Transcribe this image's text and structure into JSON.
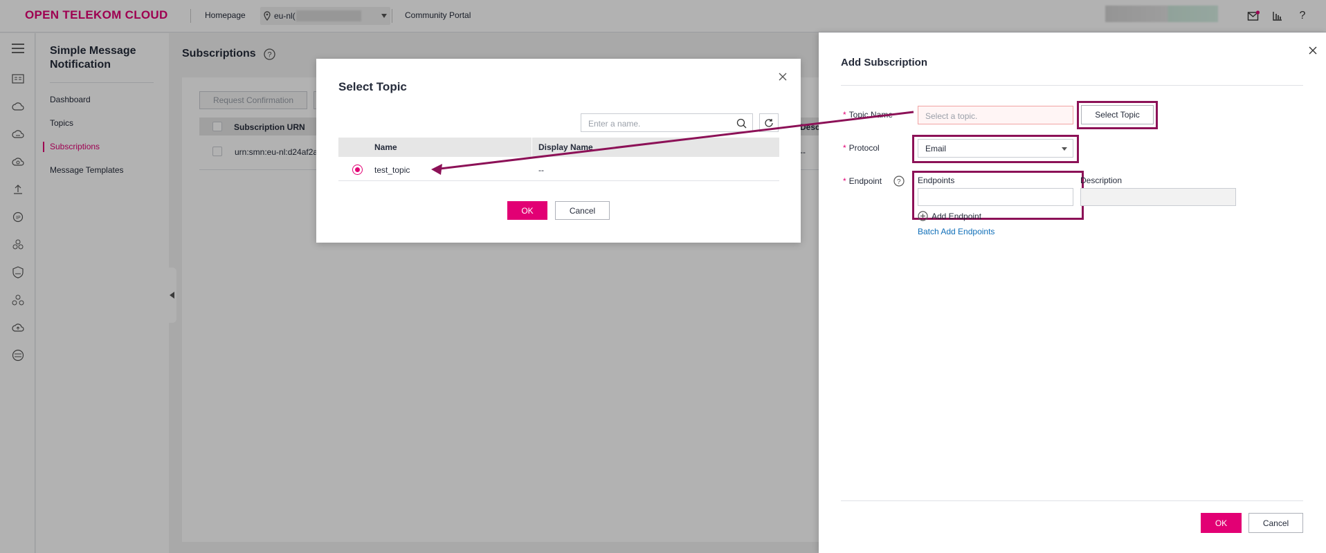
{
  "topbar": {
    "logo": "OPEN TELEKOM CLOUD",
    "homepage": "Homepage",
    "region": "eu-nl(",
    "community": "Community Portal"
  },
  "sidebar": {
    "service_title": "Simple Message Notification",
    "items": [
      {
        "label": "Dashboard"
      },
      {
        "label": "Topics"
      },
      {
        "label": "Subscriptions"
      },
      {
        "label": "Message Templates"
      }
    ]
  },
  "main": {
    "page_title": "Subscriptions",
    "toolbar": {
      "request_confirmation": "Request Confirmation"
    },
    "table": {
      "header": "Subscription URN",
      "header_partial": "Desc",
      "rows": [
        {
          "urn": "urn:smn:eu-nl:d24af2a",
          "desc": "--"
        }
      ]
    }
  },
  "select_topic_dialog": {
    "title": "Select Topic",
    "search_placeholder": "Enter a name.",
    "columns": [
      "Name",
      "Display Name"
    ],
    "rows": [
      {
        "name": "test_topic",
        "display_name": "--",
        "selected": true
      }
    ],
    "ok": "OK",
    "cancel": "Cancel"
  },
  "add_subscription": {
    "title": "Add Subscription",
    "topic_name_label": "Topic Name",
    "topic_placeholder": "Select a topic.",
    "select_topic_button": "Select Topic",
    "protocol_label": "Protocol",
    "protocol_value": "Email",
    "endpoint_label": "Endpoint",
    "endpoints_header": "Endpoints",
    "description_header": "Description",
    "add_endpoint": "Add Endpoint",
    "batch_add": "Batch Add Endpoints",
    "ok": "OK",
    "cancel": "Cancel"
  },
  "colors": {
    "brand": "#e20074",
    "annotation": "#8c1157",
    "link": "#0e6eb8"
  }
}
